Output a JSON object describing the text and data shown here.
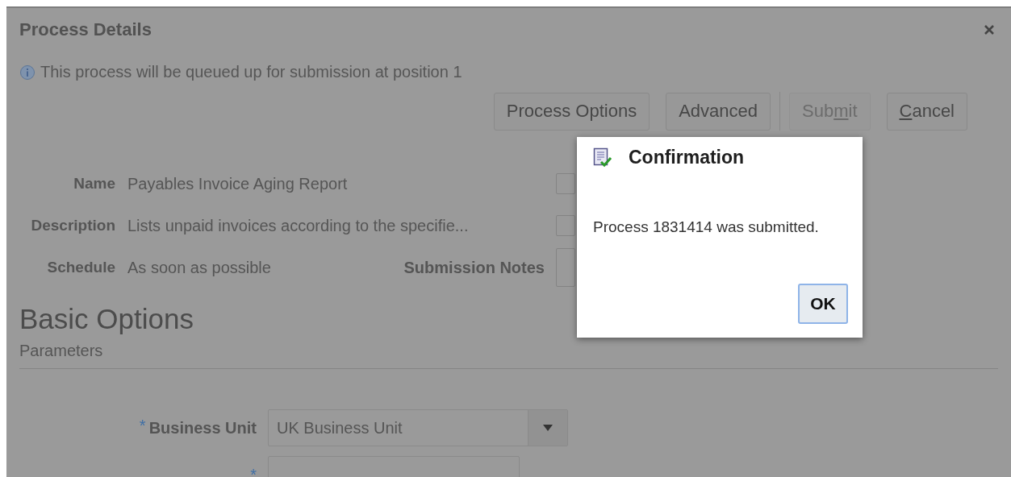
{
  "dialog": {
    "title": "Process Details",
    "info": "This process will be queued up for submission at position 1",
    "buttons": [
      {
        "label": "Process Options",
        "disabled": false
      },
      {
        "label": "Advanced",
        "disabled": false
      },
      {
        "label_parts": [
          {
            "text": "Sub",
            "underlined": false
          },
          {
            "text": "m",
            "underlined": true
          },
          {
            "text": "it",
            "underlined": false
          }
        ],
        "disabled": true
      },
      {
        "label_parts": [
          {
            "text": "C",
            "underlined": true
          },
          {
            "text": "ancel",
            "underlined": false
          }
        ],
        "disabled": false
      }
    ],
    "details": [
      {
        "label": "Name",
        "value": "Payables Invoice Aging Report"
      },
      {
        "label": "Description",
        "value": "Lists unpaid invoices according to the specifie..."
      },
      {
        "label": "Schedule",
        "value": "As soon as possible"
      }
    ],
    "notes_label": "Submission Notes",
    "section_title": "Basic Options",
    "subsection_title": "Parameters",
    "parameters": [
      {
        "label": "Business Unit",
        "value": "UK Business Unit",
        "required_mark": "*",
        "kind": "select"
      },
      {
        "required_mark": "*",
        "kind": "text"
      }
    ]
  },
  "confirmation": {
    "title": "Confirmation",
    "message": "Process 1831414 was submitted.",
    "button": "OK"
  }
}
